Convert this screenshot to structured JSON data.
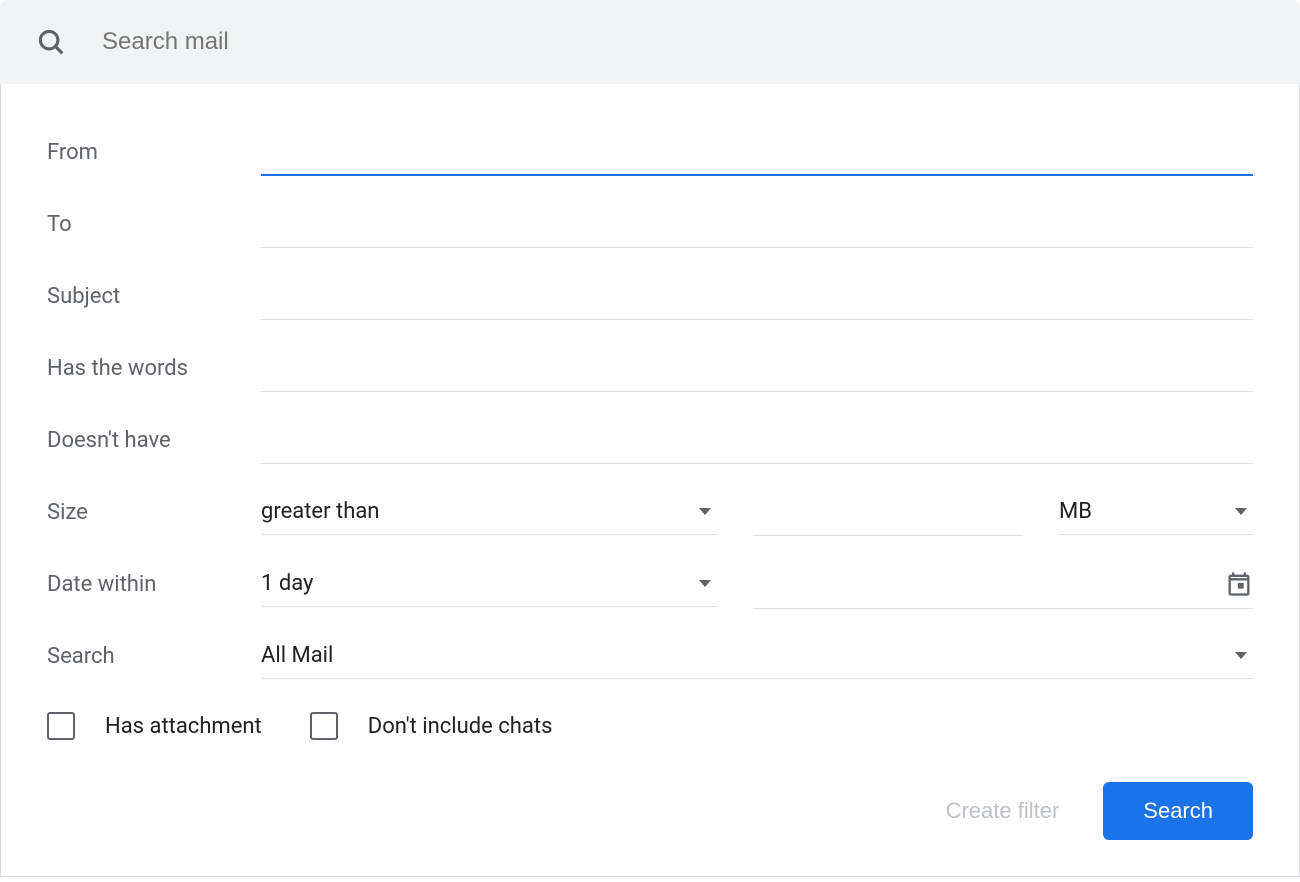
{
  "search": {
    "placeholder": "Search mail"
  },
  "fields": {
    "from": {
      "label": "From",
      "value": ""
    },
    "to": {
      "label": "To",
      "value": ""
    },
    "subject": {
      "label": "Subject",
      "value": ""
    },
    "has_words": {
      "label": "Has the words",
      "value": ""
    },
    "doesnt_have": {
      "label": "Doesn't have",
      "value": ""
    },
    "size": {
      "label": "Size",
      "comparator": "greater than",
      "value": "",
      "unit": "MB"
    },
    "date": {
      "label": "Date within",
      "range": "1 day",
      "value": ""
    },
    "search_in": {
      "label": "Search",
      "value": "All Mail"
    }
  },
  "checkboxes": {
    "has_attachment": {
      "label": "Has attachment",
      "checked": false
    },
    "exclude_chats": {
      "label": "Don't include chats",
      "checked": false
    }
  },
  "footer": {
    "create_filter": "Create filter",
    "search": "Search"
  }
}
